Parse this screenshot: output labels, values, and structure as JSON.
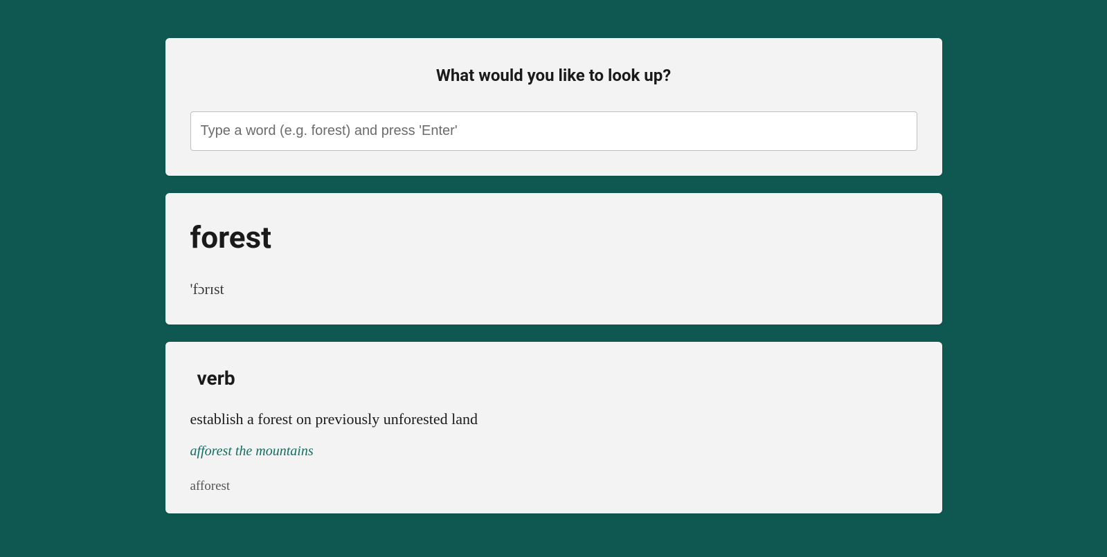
{
  "search": {
    "title": "What would you like to look up?",
    "placeholder": "Type a word (e.g. forest) and press 'Enter'",
    "value": ""
  },
  "entry": {
    "word": "forest",
    "pronunciation": "'fɔrɪst"
  },
  "definition": {
    "partOfSpeech": "verb",
    "text": "establish a forest on previously unforested land",
    "example": "afforest the mountains",
    "synonym": "afforest"
  }
}
